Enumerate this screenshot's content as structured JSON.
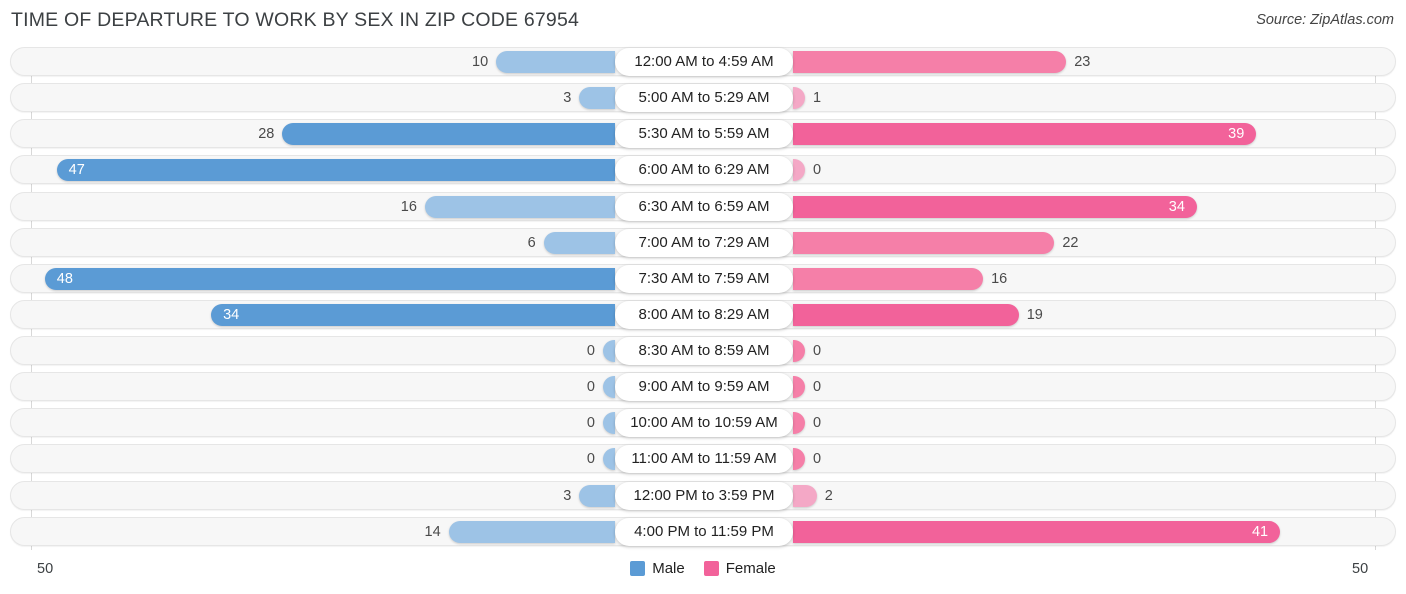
{
  "header": {
    "title": "TIME OF DEPARTURE TO WORK BY SEX IN ZIP CODE 67954",
    "source": "Source: ZipAtlas.com"
  },
  "axis": {
    "min_label": "50",
    "max_label": "50"
  },
  "legend": {
    "items": [
      {
        "label": "Male",
        "color": "#5B9BD5"
      },
      {
        "label": "Female",
        "color": "#F2629A"
      }
    ]
  },
  "colors": {
    "male_dark": "#5B9BD5",
    "male_light": "#9DC3E6",
    "female_dark": "#F2629A",
    "female_mid": "#F57FA8",
    "female_light": "#F4A8C6",
    "track": "#f7f7f7",
    "track_border": "#e6e6e6"
  },
  "chart_data": {
    "type": "bar",
    "subtype": "diverging-bidirectional",
    "title": "TIME OF DEPARTURE TO WORK BY SEX IN ZIP CODE 67954",
    "xlabel": "",
    "ylabel": "",
    "xlim": [
      50,
      50
    ],
    "axis_left_max": 50,
    "axis_right_max": 50,
    "grid": false,
    "legend_position": "bottom-center",
    "categories": [
      "12:00 AM to 4:59 AM",
      "5:00 AM to 5:29 AM",
      "5:30 AM to 5:59 AM",
      "6:00 AM to 6:29 AM",
      "6:30 AM to 6:59 AM",
      "7:00 AM to 7:29 AM",
      "7:30 AM to 7:59 AM",
      "8:00 AM to 8:29 AM",
      "8:30 AM to 8:59 AM",
      "9:00 AM to 9:59 AM",
      "10:00 AM to 10:59 AM",
      "11:00 AM to 11:59 AM",
      "12:00 PM to 3:59 PM",
      "4:00 PM to 11:59 PM"
    ],
    "series": [
      {
        "name": "Male",
        "color": "#5B9BD5",
        "values": [
          10,
          3,
          28,
          47,
          16,
          6,
          48,
          34,
          0,
          0,
          0,
          0,
          3,
          14
        ]
      },
      {
        "name": "Female",
        "color": "#F2629A",
        "values": [
          23,
          1,
          39,
          0,
          34,
          22,
          16,
          19,
          0,
          0,
          0,
          0,
          2,
          41
        ]
      }
    ]
  },
  "rows": [
    {
      "category": "12:00 AM to 4:59 AM",
      "male": 10,
      "female": 23,
      "male_label": "10",
      "female_label": "23",
      "male_shade": "light",
      "female_shade": "mid",
      "male_inside": false,
      "female_inside": false
    },
    {
      "category": "5:00 AM to 5:29 AM",
      "male": 3,
      "female": 1,
      "male_label": "3",
      "female_label": "1",
      "male_shade": "light",
      "female_shade": "light",
      "male_inside": false,
      "female_inside": false
    },
    {
      "category": "5:30 AM to 5:59 AM",
      "male": 28,
      "female": 39,
      "male_label": "28",
      "female_label": "39",
      "male_shade": "dark",
      "female_shade": "dark",
      "male_inside": false,
      "female_inside": true
    },
    {
      "category": "6:00 AM to 6:29 AM",
      "male": 47,
      "female": 0,
      "male_label": "47",
      "female_label": "0",
      "male_shade": "dark",
      "female_shade": "light",
      "male_inside": true,
      "female_inside": false
    },
    {
      "category": "6:30 AM to 6:59 AM",
      "male": 16,
      "female": 34,
      "male_label": "16",
      "female_label": "34",
      "male_shade": "light",
      "female_shade": "dark",
      "male_inside": false,
      "female_inside": true
    },
    {
      "category": "7:00 AM to 7:29 AM",
      "male": 6,
      "female": 22,
      "male_label": "6",
      "female_label": "22",
      "male_shade": "light",
      "female_shade": "mid",
      "male_inside": false,
      "female_inside": false
    },
    {
      "category": "7:30 AM to 7:59 AM",
      "male": 48,
      "female": 16,
      "male_label": "48",
      "female_label": "16",
      "male_shade": "dark",
      "female_shade": "mid",
      "male_inside": true,
      "female_inside": false
    },
    {
      "category": "8:00 AM to 8:29 AM",
      "male": 34,
      "female": 19,
      "male_label": "34",
      "female_label": "19",
      "male_shade": "dark",
      "female_shade": "dark",
      "male_inside": true,
      "female_inside": false
    },
    {
      "category": "8:30 AM to 8:59 AM",
      "male": 0,
      "female": 0,
      "male_label": "0",
      "female_label": "0",
      "male_shade": "light",
      "female_shade": "mid",
      "male_inside": false,
      "female_inside": false
    },
    {
      "category": "9:00 AM to 9:59 AM",
      "male": 0,
      "female": 0,
      "male_label": "0",
      "female_label": "0",
      "male_shade": "light",
      "female_shade": "mid",
      "male_inside": false,
      "female_inside": false
    },
    {
      "category": "10:00 AM to 10:59 AM",
      "male": 0,
      "female": 0,
      "male_label": "0",
      "female_label": "0",
      "male_shade": "light",
      "female_shade": "mid",
      "male_inside": false,
      "female_inside": false
    },
    {
      "category": "11:00 AM to 11:59 AM",
      "male": 0,
      "female": 0,
      "male_label": "0",
      "female_label": "0",
      "male_shade": "light",
      "female_shade": "mid",
      "male_inside": false,
      "female_inside": false
    },
    {
      "category": "12:00 PM to 3:59 PM",
      "male": 3,
      "female": 2,
      "male_label": "3",
      "female_label": "2",
      "male_shade": "light",
      "female_shade": "light",
      "male_inside": false,
      "female_inside": false
    },
    {
      "category": "4:00 PM to 11:59 PM",
      "male": 14,
      "female": 41,
      "male_label": "14",
      "female_label": "41",
      "male_shade": "light",
      "female_shade": "dark",
      "male_inside": false,
      "female_inside": true
    }
  ]
}
